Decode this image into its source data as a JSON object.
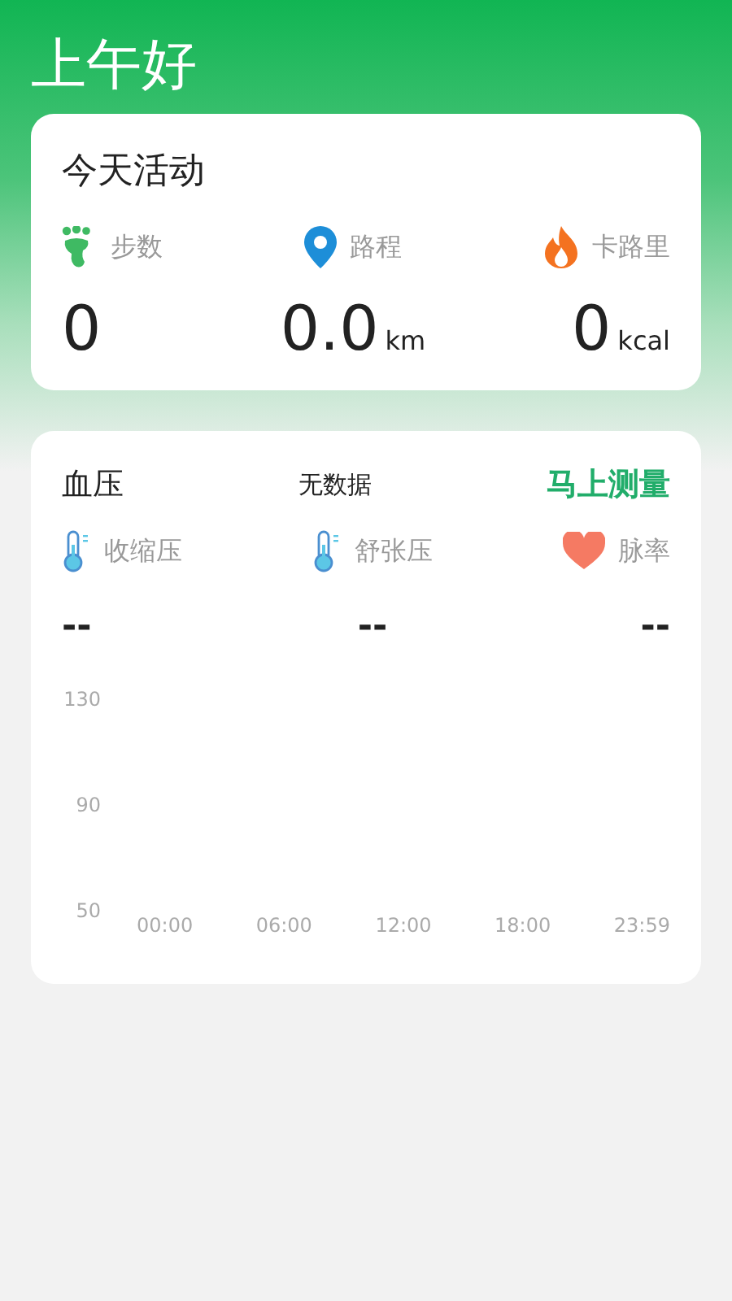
{
  "greeting": "上午好",
  "activity": {
    "title": "今天活动",
    "stats": [
      {
        "kind": "steps",
        "label": "步数",
        "value": "0"
      },
      {
        "kind": "distance",
        "label": "路程",
        "value": "0.0",
        "unit": "km"
      },
      {
        "kind": "calories",
        "label": "卡路里",
        "value": "0",
        "unit": "kcal"
      }
    ]
  },
  "blood_pressure": {
    "title": "血压",
    "status": "无数据",
    "action": "马上测量",
    "metrics": [
      {
        "kind": "systolic",
        "label": "收缩压",
        "value": "--"
      },
      {
        "kind": "diastolic",
        "label": "舒张压",
        "value": "--"
      },
      {
        "kind": "pulse",
        "label": "脉率",
        "value": "--"
      }
    ],
    "chart_data": {
      "type": "line",
      "categories": [
        "00:00",
        "06:00",
        "12:00",
        "18:00",
        "23:59"
      ],
      "ylim": [
        50,
        130
      ],
      "yticks": [
        50,
        90,
        130
      ]
    }
  }
}
